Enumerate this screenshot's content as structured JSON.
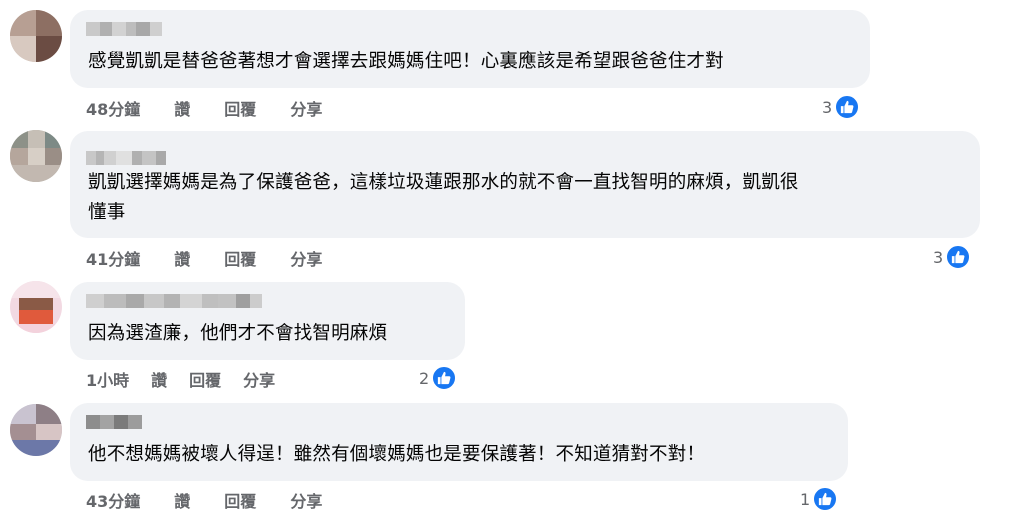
{
  "comments": [
    {
      "text": "感覺凱凱是替爸爸著想才會選擇去跟媽媽住吧！心裏應該是希望跟爸爸住才對",
      "time": "48分鐘",
      "like_label": "讚",
      "reply_label": "回覆",
      "share_label": "分享",
      "reaction_count": "3"
    },
    {
      "text": "凱凱選擇媽媽是為了保護爸爸，這樣垃圾蓮跟那水的就不會一直找智明的麻煩，凱凱很\n懂事",
      "time": "41分鐘",
      "like_label": "讚",
      "reply_label": "回覆",
      "share_label": "分享",
      "reaction_count": "3"
    },
    {
      "text": "因為選渣廉，他們才不會找智明麻煩",
      "time": "1小時",
      "like_label": "讚",
      "reply_label": "回覆",
      "share_label": "分享",
      "reaction_count": "2"
    },
    {
      "text": "他不想媽媽被壞人得逞！雖然有個壞媽媽也是要保護著！不知道猜對不對！",
      "time": "43分鐘",
      "like_label": "讚",
      "reply_label": "回覆",
      "share_label": "分享",
      "reaction_count": "1"
    }
  ],
  "icons": {
    "reaction": "thumbs-up-icon"
  },
  "colors": {
    "bubble": "#f0f2f5",
    "meta_text": "#65676b",
    "like_blue": "#1877f2"
  }
}
